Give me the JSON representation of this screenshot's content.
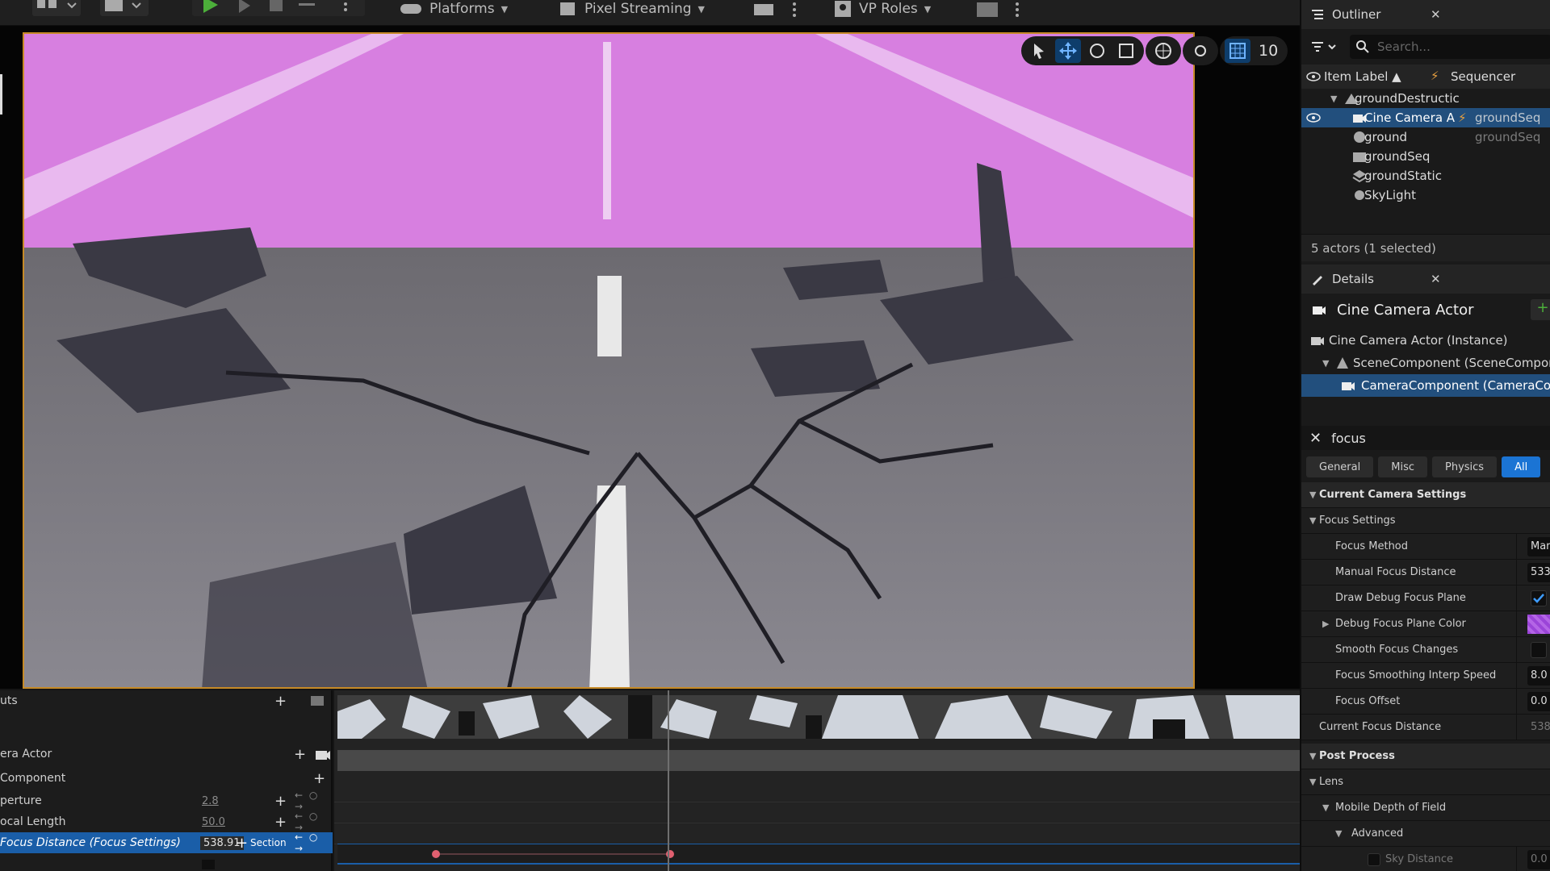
{
  "toolbar": {
    "platforms_label": "Platforms",
    "pixel_streaming_label": "Pixel Streaming",
    "vp_roles_label": "VP Roles"
  },
  "viewport": {
    "grid_snap_value": "10",
    "accent_colors": {
      "selection_border": "#c68a26",
      "active_tool": "#0e3d6b",
      "sky": "#d77fe0"
    }
  },
  "sequencer": {
    "rows": [
      {
        "label": "uts",
        "value": ""
      },
      {
        "label": "era Actor",
        "value": ""
      },
      {
        "label": "Component",
        "value": ""
      },
      {
        "label": "perture",
        "value": "2.8"
      },
      {
        "label": "ocal Length",
        "value": "50.0"
      },
      {
        "label": "Focus Distance (Focus Settings)",
        "value": "538.91",
        "section_label": "Section"
      }
    ],
    "key_nav": "← ○ →",
    "keyframe_color": "#e06070"
  },
  "outliner": {
    "title": "Outliner",
    "search_placeholder": "Search...",
    "col_item_label": "Item Label ▲",
    "col_sequencer": "Sequencer",
    "items": [
      {
        "name": "groundDestructic",
        "type": ""
      },
      {
        "name": "Cine Camera A",
        "type": "groundSeq"
      },
      {
        "name": "ground",
        "type": "groundSeq"
      },
      {
        "name": "groundSeq",
        "type": ""
      },
      {
        "name": "groundStatic",
        "type": ""
      },
      {
        "name": "SkyLight",
        "type": ""
      }
    ],
    "status": "5 actors (1 selected)"
  },
  "details": {
    "title": "Details",
    "actor_name": "Cine Camera Actor",
    "components": [
      "Cine Camera Actor (Instance)",
      "SceneComponent (SceneComponen",
      "CameraComponent (CameraComp"
    ],
    "filter_text": "focus",
    "category_tabs": [
      "General",
      "Misc",
      "Physics",
      "All"
    ],
    "properties": [
      {
        "label": "Current Camera Settings",
        "value": ""
      },
      {
        "label": "Focus Settings",
        "value": ""
      },
      {
        "label": "Focus Method",
        "value": "Mar"
      },
      {
        "label": "Manual Focus Distance",
        "value": "533"
      },
      {
        "label": "Draw Debug Focus Plane",
        "value": ""
      },
      {
        "label": "Debug Focus Plane Color",
        "value": ""
      },
      {
        "label": "Smooth Focus Changes",
        "value": ""
      },
      {
        "label": "Focus Smoothing Interp Speed",
        "value": "8.0"
      },
      {
        "label": "Focus Offset",
        "value": "0.0"
      },
      {
        "label": "Current Focus Distance",
        "value": "538"
      },
      {
        "label": "Post Process",
        "value": ""
      },
      {
        "label": "Lens",
        "value": ""
      },
      {
        "label": "Mobile Depth of Field",
        "value": ""
      },
      {
        "label": "Advanced",
        "value": ""
      },
      {
        "label": "Sky Distance",
        "value": "0.0"
      }
    ]
  }
}
